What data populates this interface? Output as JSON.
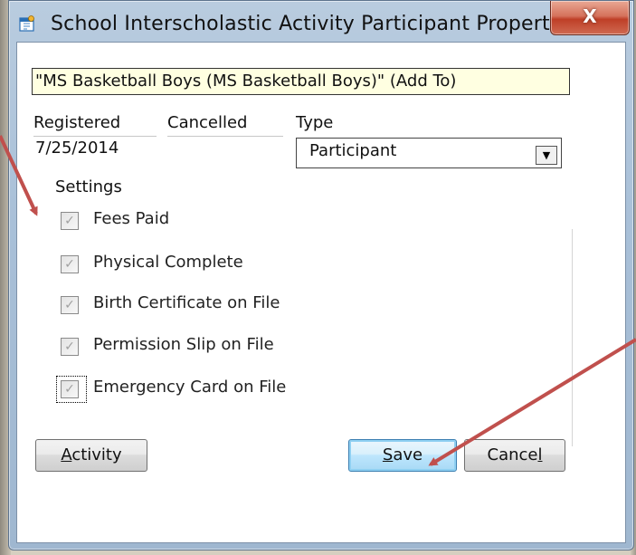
{
  "window": {
    "title": "School Interscholastic Activity Participant Propert...",
    "close_label": "X"
  },
  "header": {
    "activity_name": "\"MS Basketball Boys (MS Basketball Boys)\" (Add To)"
  },
  "fields": {
    "registered_label": "Registered",
    "registered_value": "7/25/2014",
    "cancelled_label": "Cancelled",
    "cancelled_value": "",
    "type_label": "Type",
    "type_value": "Participant",
    "dropdown_glyph": "▼"
  },
  "settings": {
    "label": "Settings",
    "items": [
      {
        "label": "Fees Paid",
        "checked": true
      },
      {
        "label": "Physical Complete",
        "checked": true
      },
      {
        "label": "Birth Certificate on File",
        "checked": true
      },
      {
        "label": "Permission Slip on File",
        "checked": true
      },
      {
        "label": "Emergency Card on File",
        "checked": true,
        "focused": true
      }
    ],
    "check_glyph": "✓"
  },
  "buttons": {
    "activity": {
      "mnemonic": "A",
      "rest": "ctivity"
    },
    "save": {
      "mnemonic": "S",
      "rest": "ave"
    },
    "cancel": {
      "pre": "Cance",
      "mnemonic": "l"
    }
  },
  "colors": {
    "annotation_arrow": "#c0504d",
    "close_button": "#c8412a",
    "name_box_bg": "#ffffe1",
    "default_button_border": "#3c7fb1"
  }
}
